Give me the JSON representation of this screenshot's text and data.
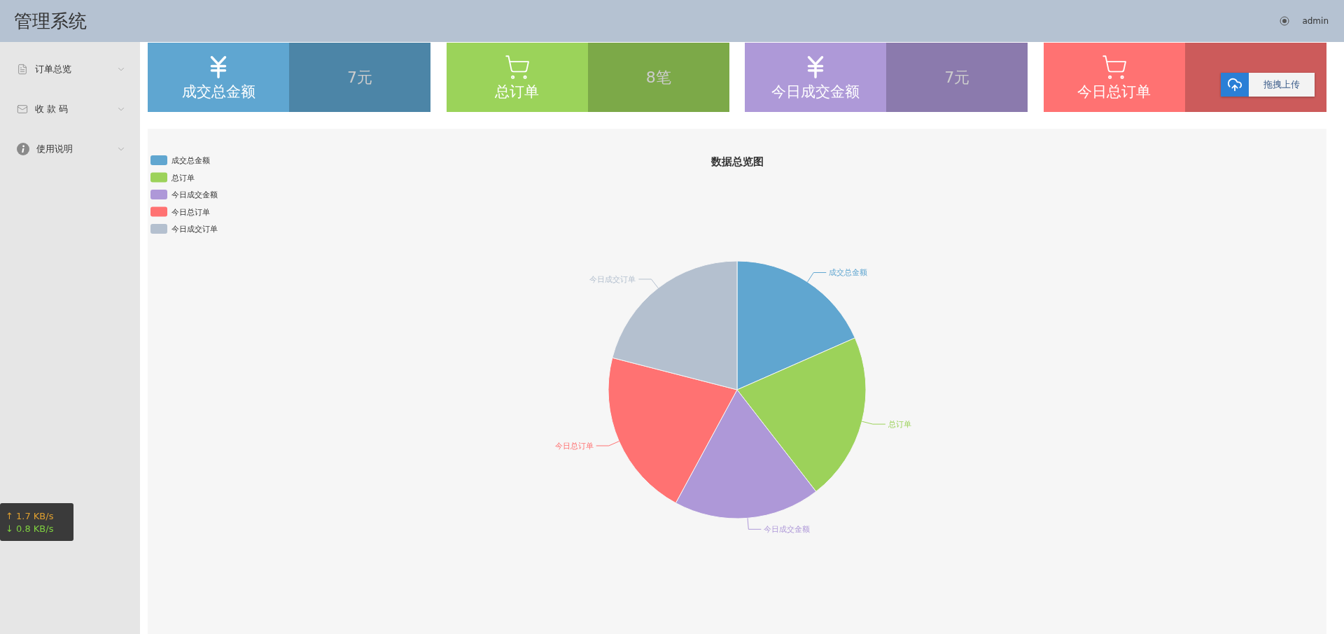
{
  "header": {
    "title": "管理系统",
    "user": "admin"
  },
  "sidebar": {
    "items": [
      {
        "label": "订单总览",
        "expanded": false
      },
      {
        "label": "收 款 码",
        "expanded": false
      },
      {
        "label": "使用说明",
        "expanded": false
      }
    ]
  },
  "network_widget": {
    "upload": "↑ 1.7 KB/s",
    "download": "↓ 0.8 KB/s"
  },
  "cards": [
    {
      "kind": "money",
      "label": "成交总金额",
      "value": "7元",
      "color": "#5fa6d1"
    },
    {
      "kind": "order",
      "label": "总订单",
      "value": "8笔",
      "color": "#9bd35a"
    },
    {
      "kind": "money",
      "label": "今日成交金额",
      "value": "7元",
      "color": "#ae99d8"
    },
    {
      "kind": "order",
      "label": "今日总订单",
      "color": "#ff7272"
    }
  ],
  "upload_widget": {
    "label": "拖拽上传"
  },
  "chart": {
    "chart_data": {
      "type": "pie",
      "title": "数据总览图",
      "legend": "top-left",
      "categories": [
        "成交总金额",
        "总订单",
        "今日成交金额",
        "今日总订单",
        "今日成交订单"
      ],
      "series": [
        {
          "colors": [
            "#60a6d0",
            "#9cd25a",
            "#ae98d8",
            "#ff7272",
            "#b4c0cf"
          ],
          "values": [
            18.4,
            21.1,
            18.4,
            21.1,
            21.0
          ]
        }
      ]
    }
  }
}
